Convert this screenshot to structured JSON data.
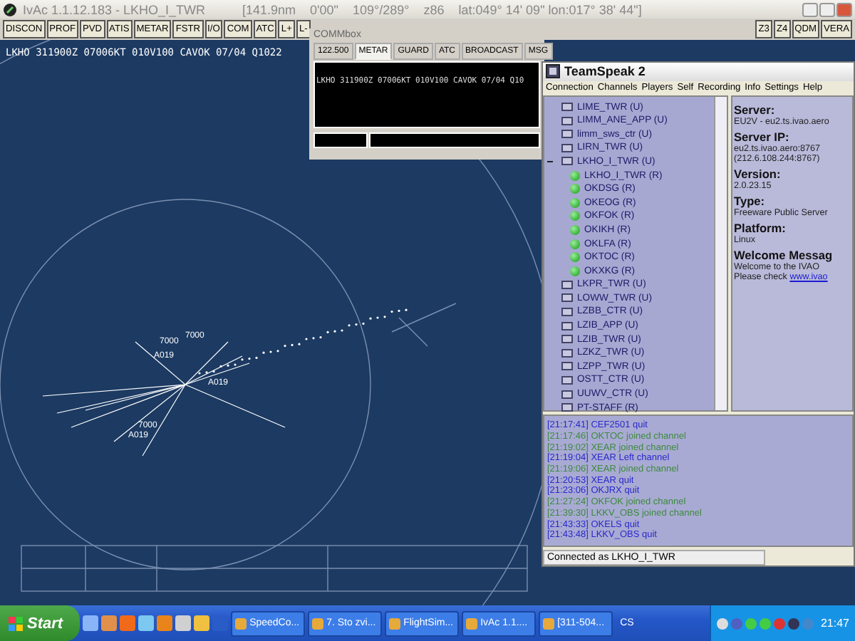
{
  "app_window": {
    "title": "IvAc 1.1.12.183 - LKHO_I_TWR",
    "readout": "[141.9nm    0'00\"    109°/289°    z86    lat:049° 14' 09\" lon:017° 38' 44\"]"
  },
  "toolbar": {
    "left": [
      "DISCON",
      "PROF",
      "PVD",
      "ATIS",
      "METAR",
      "FSTR",
      "I/O",
      "COM",
      "ATC",
      "L+",
      "L-"
    ],
    "right": [
      "Z3",
      "Z4",
      "QDM",
      "VERA"
    ]
  },
  "metar_line": "LKHO 311900Z 07006KT 010V100 CAVOK 07/04 Q1022",
  "radar_labels": [
    "7000",
    "7000",
    "A019",
    "A019",
    "7000",
    "A019"
  ],
  "comm_window": {
    "title": "COMMbox",
    "tabs": [
      {
        "label": "122.500",
        "selected": false
      },
      {
        "label": "METAR",
        "selected": true
      },
      {
        "label": "GUARD",
        "selected": false
      },
      {
        "label": "ATC",
        "selected": false
      },
      {
        "label": "BROADCAST",
        "selected": false
      },
      {
        "label": "MSG",
        "selected": false
      }
    ],
    "text": "LKHO 311900Z 07006KT 010V100 CAVOK 07/04 Q10"
  },
  "teamspeak": {
    "title": "TeamSpeak 2",
    "menu": [
      "Connection",
      "Channels",
      "Players",
      "Self",
      "Recording",
      "Info",
      "Settings",
      "Help"
    ],
    "tree": [
      {
        "label": "LIME_TWR   (U)",
        "expanded": false
      },
      {
        "label": "LIMM_ANE_APP   (U)",
        "expanded": false
      },
      {
        "label": "limm_sws_ctr   (U)",
        "expanded": false
      },
      {
        "label": "LIRN_TWR   (U)",
        "expanded": false
      },
      {
        "label": "LKHO_I_TWR   (U)",
        "expanded": true,
        "children": [
          {
            "label": "LKHO_I_TWR  (R)"
          },
          {
            "label": "OKDSG  (R)"
          },
          {
            "label": "OKEOG  (R)"
          },
          {
            "label": "OKFOK  (R)"
          },
          {
            "label": "OKIKH  (R)"
          },
          {
            "label": "OKLFA  (R)"
          },
          {
            "label": "OKTOC  (R)"
          },
          {
            "label": "OKXKG  (R)"
          }
        ]
      },
      {
        "label": "LKPR_TWR   (U)",
        "expanded": false
      },
      {
        "label": "LOWW_TWR   (U)",
        "expanded": false
      },
      {
        "label": "LZBB_CTR   (U)",
        "expanded": false
      },
      {
        "label": "LZIB_APP   (U)",
        "expanded": false
      },
      {
        "label": "LZIB_TWR   (U)",
        "expanded": false
      },
      {
        "label": "LZKZ_TWR   (U)",
        "expanded": false
      },
      {
        "label": "LZPP_TWR   (U)",
        "expanded": false
      },
      {
        "label": "OSTT_CTR   (U)",
        "expanded": false
      },
      {
        "label": "UUWV_CTR   (U)",
        "expanded": false
      },
      {
        "label": "PT-STAFF   (R)",
        "expanded": false
      }
    ],
    "info": [
      {
        "kind": "heading",
        "text": "Server:"
      },
      {
        "kind": "line",
        "text": "EU2V - eu2.ts.ivao.aero"
      },
      {
        "kind": "heading",
        "text": "Server IP:"
      },
      {
        "kind": "line",
        "text": "eu2.ts.ivao.aero:8767"
      },
      {
        "kind": "line",
        "text": "(212.6.108.244:8767)"
      },
      {
        "kind": "heading",
        "text": "Version:"
      },
      {
        "kind": "line",
        "text": "2.0.23.15"
      },
      {
        "kind": "heading",
        "text": "Type:"
      },
      {
        "kind": "line",
        "text": "Freeware Public Server"
      },
      {
        "kind": "heading",
        "text": "Platform:"
      },
      {
        "kind": "line",
        "text": "Linux"
      },
      {
        "kind": "heading",
        "text": "Welcome Messag"
      },
      {
        "kind": "line",
        "text": "Welcome to the IVAO"
      },
      {
        "kind": "link_line",
        "text": "Please check",
        "link": "www.ivao"
      }
    ],
    "log": [
      {
        "text": "[21:17:41] CEF2501 quit",
        "color": "#2828c8"
      },
      {
        "text": "[21:17:46] OKTOC joined channel",
        "color": "#3c8a3c"
      },
      {
        "text": "[21:19:02] XEAR joined channel",
        "color": "#3c8a3c"
      },
      {
        "text": "[21:19:04] XEAR Left channel",
        "color": "#2828c8"
      },
      {
        "text": "[21:19:06] XEAR joined channel",
        "color": "#3c8a3c"
      },
      {
        "text": "[21:20:53] XEAR quit",
        "color": "#2828c8"
      },
      {
        "text": "[21:23:06] OKJRX quit",
        "color": "#2828c8"
      },
      {
        "text": "[21:27:24] OKFOK joined channel",
        "color": "#3c8a3c"
      },
      {
        "text": "[21:39:30] LKKV_OBS joined channel",
        "color": "#3c8a3c"
      },
      {
        "text": "[21:43:33] OKELS quit",
        "color": "#2828c8"
      },
      {
        "text": "[21:43:48] LKKV_OBS quit",
        "color": "#2828c8"
      }
    ],
    "status": "Connected as LKHO_I_TWR"
  },
  "taskbar": {
    "start": "Start",
    "tasks": [
      "SpeedCo...",
      "7. Sto zvi...",
      "FlightSim...",
      "IvAc 1.1....",
      "[311-504..."
    ],
    "tray_label": "CS",
    "clock": "21:47"
  }
}
